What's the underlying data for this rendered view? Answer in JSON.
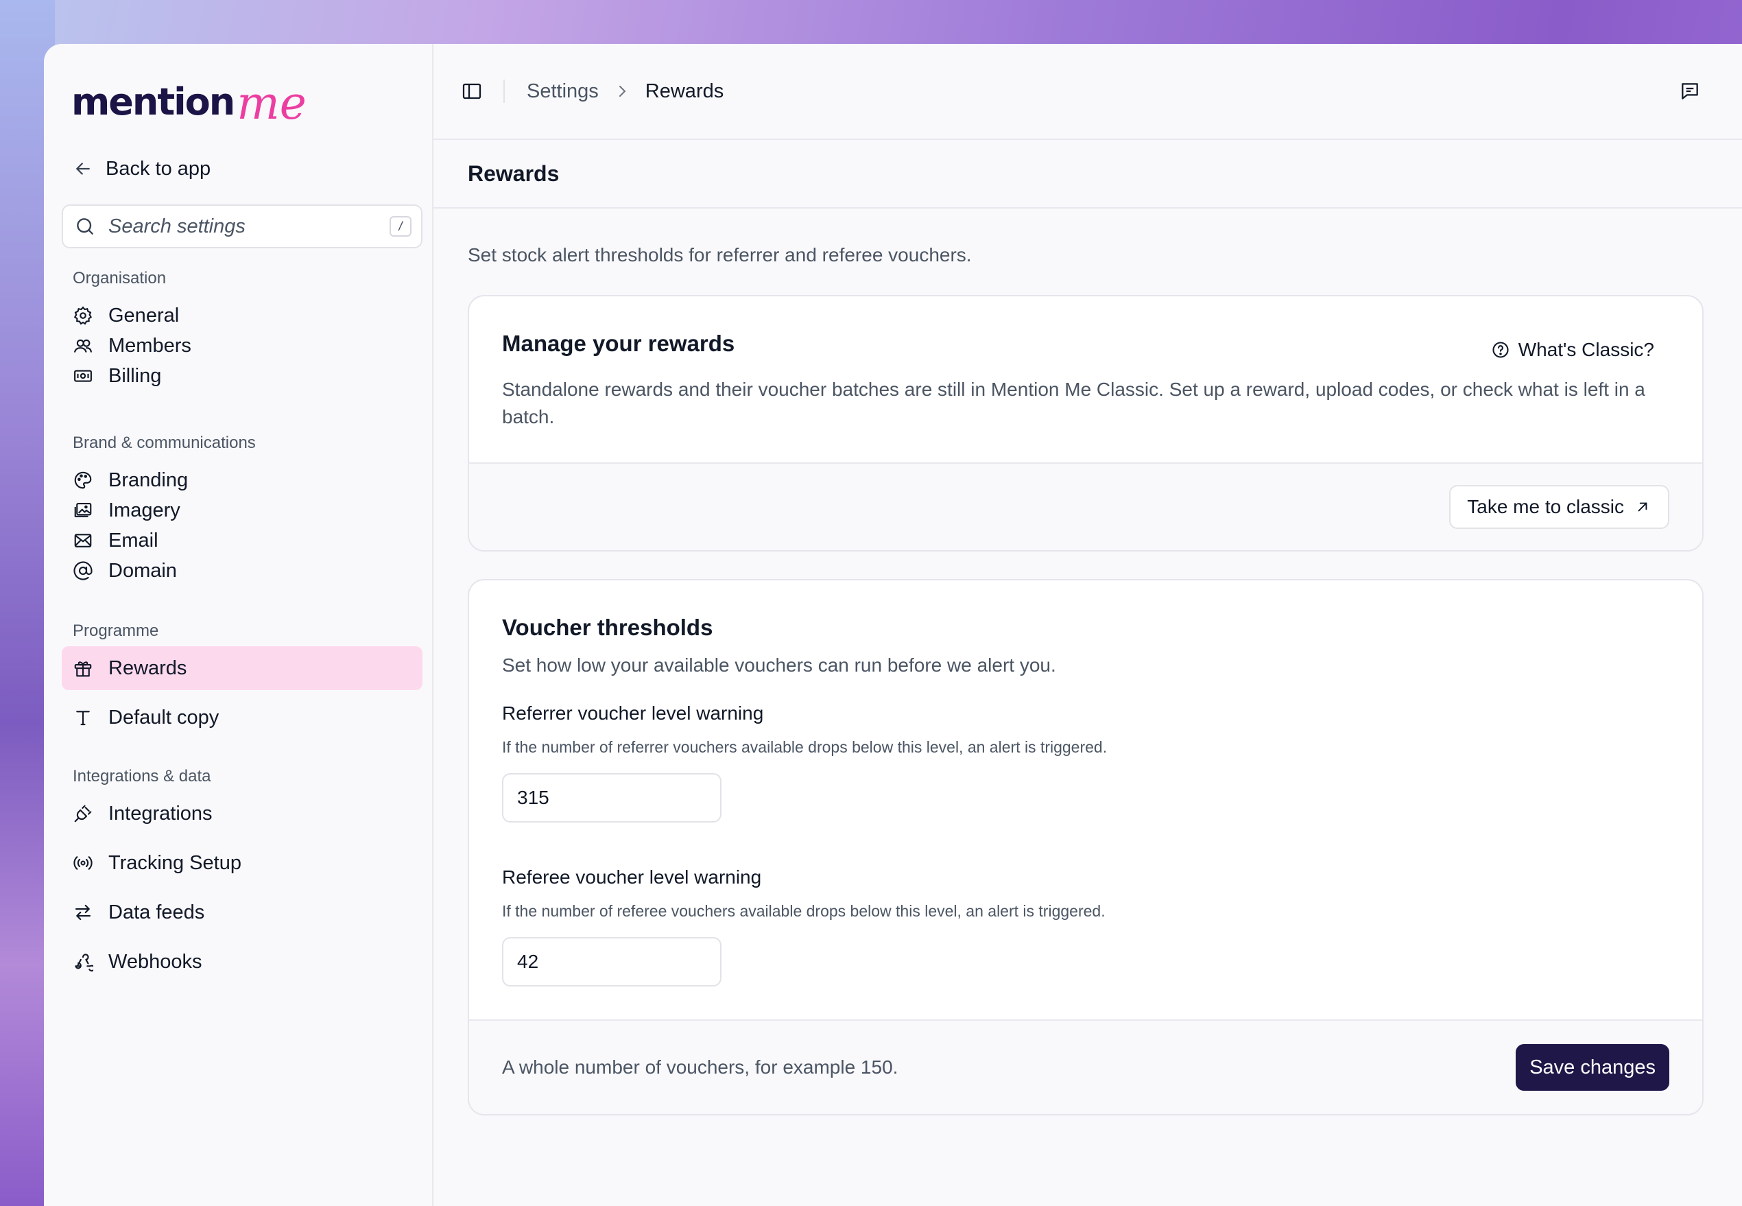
{
  "logo": {
    "word": "mention",
    "script": "me"
  },
  "sidebar": {
    "back_label": "Back to app",
    "search": {
      "placeholder": "Search settings",
      "shortcut": "/"
    },
    "sections": [
      {
        "title": "Organisation",
        "items": [
          {
            "label": "General",
            "icon": "gear-icon"
          },
          {
            "label": "Members",
            "icon": "users-icon"
          },
          {
            "label": "Billing",
            "icon": "banknote-icon"
          }
        ]
      },
      {
        "title": "Brand & communications",
        "items": [
          {
            "label": "Branding",
            "icon": "palette-icon"
          },
          {
            "label": "Imagery",
            "icon": "images-icon"
          },
          {
            "label": "Email",
            "icon": "mail-icon"
          },
          {
            "label": "Domain",
            "icon": "at-sign-icon"
          }
        ]
      },
      {
        "title": "Programme",
        "items": [
          {
            "label": "Rewards",
            "icon": "gift-icon",
            "active": true
          },
          {
            "label": "Default copy",
            "icon": "type-icon"
          }
        ]
      },
      {
        "title": "Integrations & data",
        "items": [
          {
            "label": "Integrations",
            "icon": "plug-icon"
          },
          {
            "label": "Tracking Setup",
            "icon": "radio-icon"
          },
          {
            "label": "Data feeds",
            "icon": "arrows-left-right-icon"
          },
          {
            "label": "Webhooks",
            "icon": "webhook-icon"
          }
        ]
      }
    ]
  },
  "topbar": {
    "breadcrumb": [
      "Settings",
      "Rewards"
    ]
  },
  "page": {
    "title": "Rewards",
    "intro": "Set stock alert thresholds for referrer and referee vouchers."
  },
  "manage_card": {
    "title": "Manage your rewards",
    "help_label": "What's Classic?",
    "text": "Standalone rewards and their voucher batches are still in Mention Me Classic. Set up a reward, upload codes, or check what is left in a batch.",
    "button_label": "Take me to classic"
  },
  "threshold_card": {
    "title": "Voucher thresholds",
    "subtitle": "Set how low your available vouchers can run before we alert you.",
    "referrer": {
      "label": "Referrer voucher level warning",
      "help": "If the number of referrer vouchers available drops below this level, an alert is triggered.",
      "value": "315"
    },
    "referee": {
      "label": "Referee voucher level warning",
      "help": "If the number of referee vouchers available drops below this level, an alert is triggered.",
      "value": "42"
    },
    "foot_note": "A whole number of vouchers, for example 150.",
    "save_label": "Save changes"
  },
  "colors": {
    "accent_pink": "#ec3ea1",
    "brand_navy": "#1e1748",
    "active_nav_bg": "#fdd9ee"
  }
}
